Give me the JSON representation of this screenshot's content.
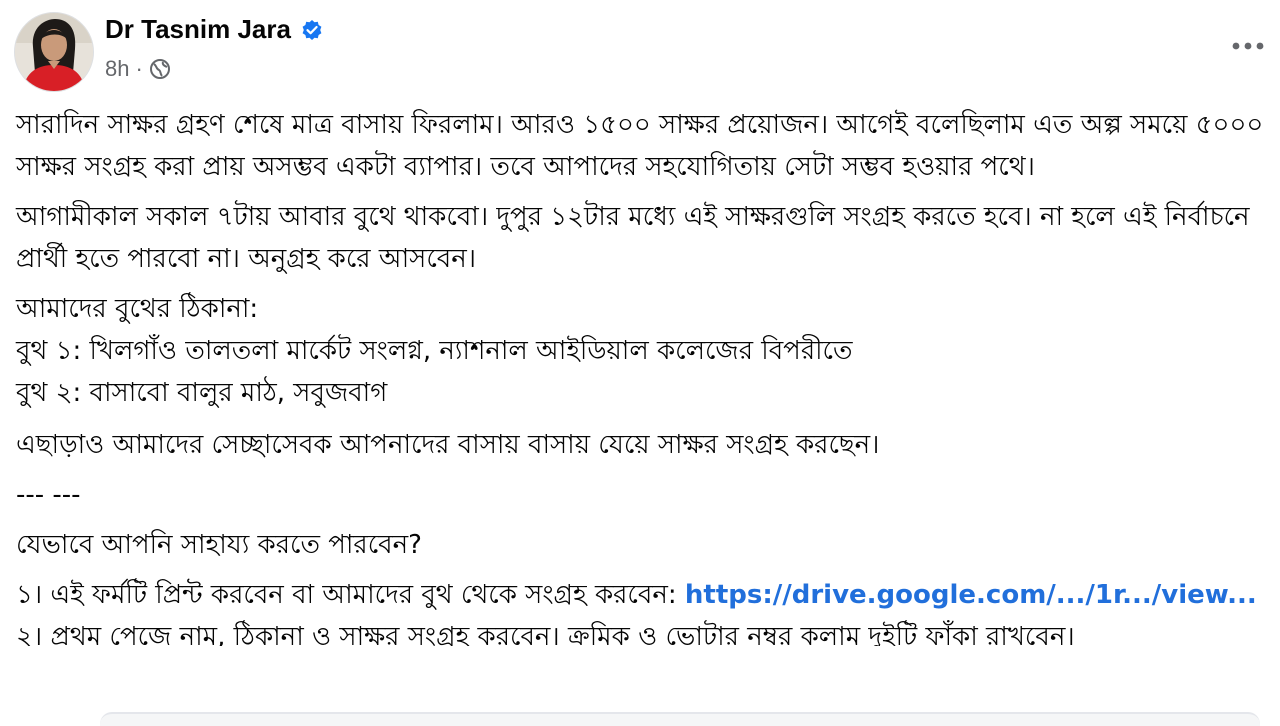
{
  "author": {
    "name": "Dr Tasnim Jara",
    "verified": true
  },
  "meta": {
    "time": "8h",
    "separator": "·",
    "audience_icon": "globe-icon"
  },
  "icons": {
    "more": "more-options-icon",
    "verified": "verified-badge-icon"
  },
  "colors": {
    "link": "#216fdb",
    "verified": "#1877f2",
    "meta": "#65676b",
    "text": "#050505",
    "avatar_shirt": "#d81f26"
  },
  "post": {
    "p1": "সারাদিন সাক্ষর গ্রহণ শেষে মাত্র বাসায় ফিরলাম। আরও ১৫০০ সাক্ষর প্রয়োজন। আগেই বলেছিলাম এত অল্প সময়ে ৫০০০ সাক্ষর সংগ্রহ করা প্রায় অসম্ভব একটা ব্যাপার। তবে আপাদের সহযোগিতায় সেটা সম্ভব হওয়ার পথে।",
    "p2": "আগামীকাল সকাল ৭টায় আবার বুথে থাকবো। দুপুর ১২টার মধ্যে এই সাক্ষরগুলি সংগ্রহ করতে হবে। না হলে এই নির্বাচনে প্রার্থী হতে পারবো না। অনুগ্রহ করে আসবেন।",
    "booth_heading": "আমাদের বুথের ঠিকানা:",
    "booth1": "বুথ ১: খিলগাঁও তালতলা মার্কেট সংলগ্ন, ন্যাশনাল আইডিয়াল কলেজের বিপরীতে",
    "booth2": "বুথ ২: বাসাবো বালুর মাঠ, সবুজবাগ",
    "p4": "এছাড়াও আমাদের সেচ্ছাসেবক আপনাদের বাসায় বাসায় যেয়ে সাক্ষর সংগ্রহ করছেন।",
    "divider": "--- ---",
    "question": "যেভাবে আপনি সাহায্য করতে পারবেন?",
    "step1_text": "১। এই ফর্মটি প্রিন্ট করবেন বা আমাদের বুথ থেকে সংগ্রহ করবেন: ",
    "step1_link": "https://drive.google.com/.../1r.../view...",
    "step2_partial": "২। প্রথম পেজে নাম, ঠিকানা ও সাক্ষর সংগ্রহ করবেন। ক্রমিক ও ভোটার নম্বর কলাম দুইটি ফাঁকা রাখবেন।"
  }
}
